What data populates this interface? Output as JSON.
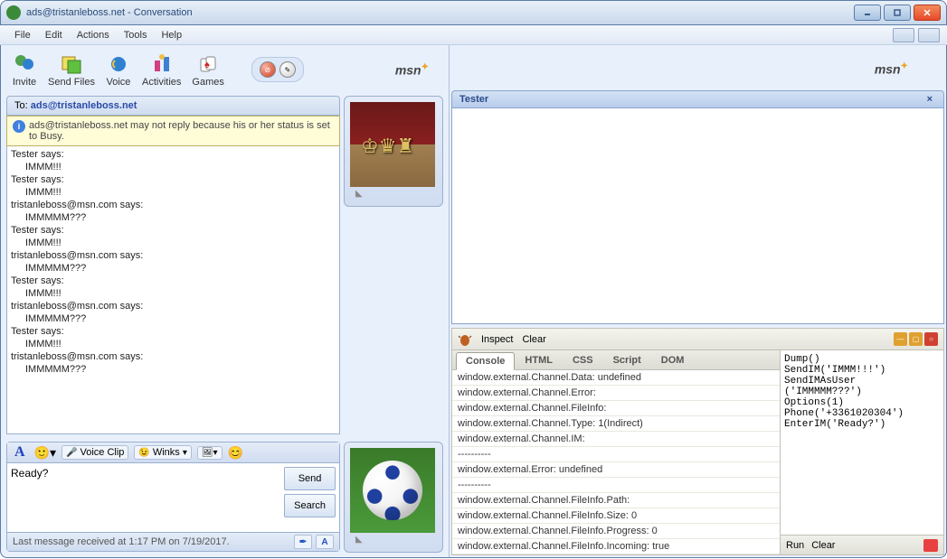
{
  "window": {
    "title": "ads@tristanleboss.net - Conversation"
  },
  "menu": [
    "File",
    "Edit",
    "Actions",
    "Tools",
    "Help"
  ],
  "toolbar": [
    {
      "label": "Invite"
    },
    {
      "label": "Send Files"
    },
    {
      "label": "Voice"
    },
    {
      "label": "Activities"
    },
    {
      "label": "Games"
    }
  ],
  "brand": "msn",
  "to": {
    "label": "To:",
    "email": "ads@tristanleboss.net"
  },
  "info_banner": "ads@tristanleboss.net may not reply because his or her status is set to Busy.",
  "messages": [
    {
      "who": "Tester says:",
      "text": "IMMM!!!"
    },
    {
      "who": "Tester says:",
      "text": "IMMM!!!"
    },
    {
      "who": "tristanleboss@msn.com says:",
      "text": "IMMMMM???"
    },
    {
      "who": "Tester says:",
      "text": "IMMM!!!"
    },
    {
      "who": "tristanleboss@msn.com says:",
      "text": "IMMMMM???"
    },
    {
      "who": "Tester says:",
      "text": "IMMM!!!"
    },
    {
      "who": "tristanleboss@msn.com says:",
      "text": "IMMMMM???"
    },
    {
      "who": "Tester says:",
      "text": "IMMM!!!"
    },
    {
      "who": "tristanleboss@msn.com says:",
      "text": "IMMMMM???"
    }
  ],
  "compose": {
    "voice_clip": "Voice Clip",
    "winks": "Winks",
    "text": "Ready?",
    "send": "Send",
    "search": "Search",
    "status": "Last message received at 1:17 PM on 7/19/2017."
  },
  "right_panel": {
    "title": "Tester"
  },
  "firebug": {
    "inspect": "Inspect",
    "clear": "Clear",
    "tabs": [
      "Console",
      "HTML",
      "CSS",
      "Script",
      "DOM"
    ],
    "active_tab": 0,
    "console": [
      "window.external.Channel.Data: undefined",
      "window.external.Channel.Error:",
      "window.external.Channel.FileInfo:",
      "window.external.Channel.Type: 1(Indirect)",
      "window.external.Channel.IM:",
      "----------",
      "window.external.Error: undefined",
      "----------",
      "window.external.Channel.FileInfo.Path:",
      "window.external.Channel.FileInfo.Size: 0",
      "window.external.Channel.FileInfo.Progress: 0",
      "window.external.Channel.FileInfo.Incoming: true"
    ],
    "commands": "Dump()\nSendIM('IMMM!!!')\nSendIMAsUser\n('IMMMMM???')\nOptions(1)\nPhone('+3361020304')\nEnterIM('Ready?')",
    "run": "Run",
    "clear2": "Clear"
  }
}
